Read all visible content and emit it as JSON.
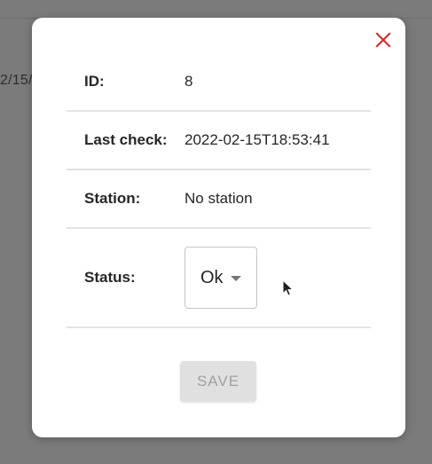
{
  "backdrop": {
    "partial_text": "2/15/"
  },
  "dialog": {
    "close_label": "",
    "rows": [
      {
        "label": "ID:",
        "value": "8"
      },
      {
        "label": "Last check:",
        "value": "2022-02-15T18:53:41"
      },
      {
        "label": "Station:",
        "value": "No station"
      }
    ],
    "status": {
      "label": "Status:",
      "selected": "Ok"
    },
    "save_label": "SAVE"
  },
  "colors": {
    "close_icon": "#d32f2f",
    "backdrop": "#7b7b7b",
    "save_disabled_bg": "#e0e0e0",
    "save_disabled_text": "#a1a1a1"
  },
  "icons": {
    "close": "close-icon",
    "dropdown": "chevron-down-icon",
    "cursor": "mouse-pointer-icon"
  }
}
